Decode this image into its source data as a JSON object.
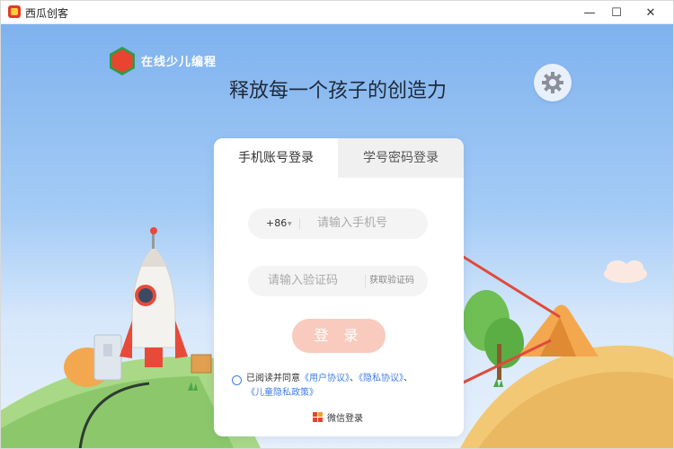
{
  "window": {
    "title": "西瓜创客",
    "minimize": "—",
    "maximize": "☐",
    "close": "✕"
  },
  "brand": {
    "logo_text": "西瓜创客",
    "name": "在线少儿编程"
  },
  "slogan": "释放每一个孩子的创造力",
  "login": {
    "tabs": [
      "手机账号登录",
      "学号密码登录"
    ],
    "active_tab": 0,
    "country_code": "+86",
    "phone_placeholder": "请输入手机号",
    "code_placeholder": "请输入验证码",
    "get_code": "获取验证码",
    "submit": "登 录",
    "agreement_prefix": "已阅读并同意",
    "user_agreement": "《用户协议》",
    "sep": "、",
    "privacy_agreement": "《隐私协议》",
    "child_privacy": "《儿童隐私政策》",
    "wechat_login": "微信登录"
  },
  "colors": {
    "accent_blue": "#3f7ee8",
    "login_button": "#f8cbbe",
    "annotation_arrow": "#e04a3c"
  }
}
